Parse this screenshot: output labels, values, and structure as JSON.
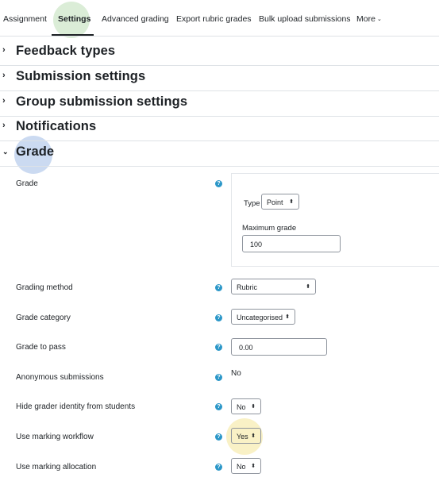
{
  "tabs": {
    "assignment": "Assignment",
    "settings": "Settings",
    "advanced_grading": "Advanced grading",
    "export_rubric": "Export rubric grades",
    "bulk_upload": "Bulk upload submissions",
    "more": "More"
  },
  "sections": {
    "feedback_types": "Feedback types",
    "submission_settings": "Submission settings",
    "group_submission_settings": "Group submission settings",
    "notifications": "Notifications",
    "grade": "Grade"
  },
  "grade": {
    "label": "Grade",
    "type_label": "Type",
    "type_value": "Point",
    "max_grade_label": "Maximum grade",
    "max_grade_value": "100"
  },
  "grading_method": {
    "label": "Grading method",
    "value": "Rubric"
  },
  "grade_category": {
    "label": "Grade category",
    "value": "Uncategorised"
  },
  "grade_to_pass": {
    "label": "Grade to pass",
    "value": "0.00"
  },
  "anonymous_submissions": {
    "label": "Anonymous submissions",
    "value": "No"
  },
  "hide_grader": {
    "label": "Hide grader identity from students",
    "value": "No"
  },
  "marking_workflow": {
    "label": "Use marking workflow",
    "value": "Yes"
  },
  "marking_allocation": {
    "label": "Use marking allocation",
    "value": "No"
  },
  "icons": {
    "help": "question-circle-icon",
    "expand": "chevron-right-icon",
    "collapse": "chevron-down-icon"
  },
  "colors": {
    "help_icon": "#2b97c8",
    "highlight_settings": "#d5ead0",
    "highlight_grade": "#c5d6ef",
    "highlight_workflow": "#f8efc0"
  }
}
